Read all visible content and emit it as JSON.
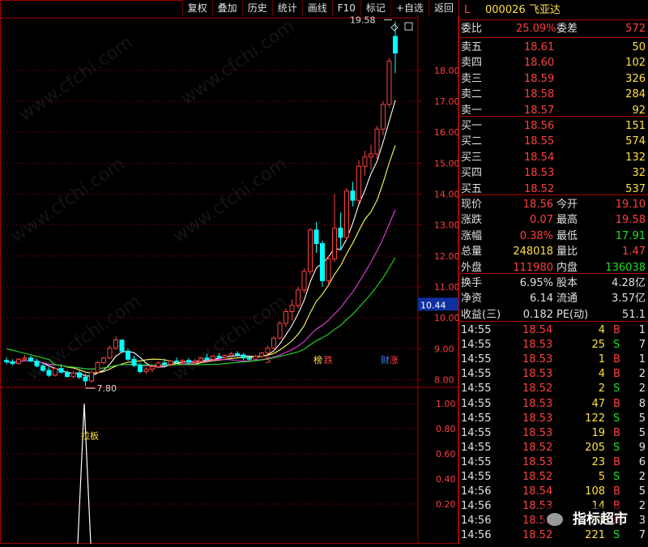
{
  "toolbar": {
    "buttons": [
      "复权",
      "叠加",
      "历史",
      "统计",
      "画线",
      "F10",
      "标记",
      "+自选",
      "返回"
    ]
  },
  "stock": {
    "flag": "L",
    "code": "000026",
    "name": "飞亚达"
  },
  "ratio": {
    "wb_label": "委比",
    "wb_value": "25.09%",
    "wc_label": "委差",
    "wc_value": "572"
  },
  "asks": [
    {
      "label": "卖五",
      "price": "18.61",
      "vol": "50"
    },
    {
      "label": "卖四",
      "price": "18.60",
      "vol": "102"
    },
    {
      "label": "卖三",
      "price": "18.59",
      "vol": "326"
    },
    {
      "label": "卖二",
      "price": "18.58",
      "vol": "284"
    },
    {
      "label": "卖一",
      "price": "18.57",
      "vol": "92"
    }
  ],
  "bids": [
    {
      "label": "买一",
      "price": "18.56",
      "vol": "151"
    },
    {
      "label": "买二",
      "price": "18.55",
      "vol": "574"
    },
    {
      "label": "买三",
      "price": "18.54",
      "vol": "132"
    },
    {
      "label": "买四",
      "price": "18.53",
      "vol": "32"
    },
    {
      "label": "买五",
      "price": "18.52",
      "vol": "537"
    }
  ],
  "stats": [
    {
      "l1": "现价",
      "v1": "18.56",
      "l2": "今开",
      "v2": "19.10"
    },
    {
      "l1": "涨跌",
      "v1": "0.07",
      "l2": "最高",
      "v2": "19.58"
    },
    {
      "l1": "涨幅",
      "v1": "0.38%",
      "l2": "最低",
      "v2": "17.91"
    },
    {
      "l1": "总量",
      "v1": "248018",
      "l2": "量比",
      "v2": "1.47"
    },
    {
      "l1": "外盘",
      "v1": "111980",
      "l2": "内盘",
      "v2": "136038"
    }
  ],
  "stats2": [
    {
      "l1": "换手",
      "v1": "6.95%",
      "l2": "股本",
      "v2": "4.28亿"
    },
    {
      "l1": "净资",
      "v1": "6.14",
      "l2": "流通",
      "v2": "3.57亿"
    },
    {
      "l1": "收益(三)",
      "v1": "0.182",
      "l2": "PE(动)",
      "v2": "51.1"
    }
  ],
  "ticks": [
    {
      "time": "14:55",
      "price": "18.54",
      "vol": "4",
      "side": "B",
      "n": "1"
    },
    {
      "time": "14:55",
      "price": "18.53",
      "vol": "25",
      "side": "S",
      "n": "7"
    },
    {
      "time": "14:55",
      "price": "18.53",
      "vol": "1",
      "side": "B",
      "n": "1"
    },
    {
      "time": "14:55",
      "price": "18.53",
      "vol": "4",
      "side": "B",
      "n": "2"
    },
    {
      "time": "14:55",
      "price": "18.52",
      "vol": "2",
      "side": "S",
      "n": "2"
    },
    {
      "time": "14:55",
      "price": "18.53",
      "vol": "47",
      "side": "B",
      "n": "8"
    },
    {
      "time": "14:55",
      "price": "18.53",
      "vol": "122",
      "side": "S",
      "n": "5"
    },
    {
      "time": "14:55",
      "price": "18.53",
      "vol": "19",
      "side": "B",
      "n": "5"
    },
    {
      "time": "14:55",
      "price": "18.52",
      "vol": "205",
      "side": "S",
      "n": "9"
    },
    {
      "time": "14:55",
      "price": "18.53",
      "vol": "23",
      "side": "B",
      "n": "6"
    },
    {
      "time": "14:55",
      "price": "18.52",
      "vol": "5",
      "side": "S",
      "n": "2"
    },
    {
      "time": "14:56",
      "price": "18.54",
      "vol": "108",
      "side": "B",
      "n": "5"
    },
    {
      "time": "14:56",
      "price": "18.53",
      "vol": "14",
      "side": "B",
      "n": "2"
    },
    {
      "time": "14:56",
      "price": "18.53",
      "vol": "4",
      "side": "B",
      "n": "3"
    },
    {
      "time": "14:56",
      "price": "18.52",
      "vol": "221",
      "side": "S",
      "n": "7"
    }
  ],
  "annotations": {
    "high": "19.58",
    "low": "7.80",
    "s_mark": "S",
    "rank_label": "榜",
    "rank_value": "跌",
    "cai_label": "财",
    "cai_value": "涨",
    "pull_label": "拉板"
  },
  "price_badge": "10.44",
  "watermark": "www.cfchi.com",
  "brand": {
    "text": "指标超市"
  },
  "colors": {
    "up": "#ff4040",
    "down": "#00ffff",
    "ma5": "#ffffff",
    "ma10": "#ffff60",
    "ma20": "#e040e0",
    "ma60": "#20e020",
    "grid": "#a00000"
  },
  "chart_data": {
    "type": "candlestick",
    "y_ticks": [
      8.0,
      9.0,
      10.0,
      11.0,
      12.0,
      13.0,
      14.0,
      15.0,
      16.0,
      17.0,
      18.0
    ],
    "y_tick_labels": [
      "8.00",
      "9.00",
      "10.00",
      "11.00",
      "12.00",
      "13.00",
      "14.00",
      "15.00",
      "16.00",
      "17.00",
      "18.00"
    ],
    "ylim": [
      7.75,
      19.7
    ],
    "candles": [
      [
        8.62,
        8.72,
        8.5,
        8.58
      ],
      [
        8.58,
        8.66,
        8.46,
        8.52
      ],
      [
        8.52,
        8.7,
        8.48,
        8.66
      ],
      [
        8.66,
        8.8,
        8.6,
        8.7
      ],
      [
        8.7,
        8.78,
        8.56,
        8.6
      ],
      [
        8.6,
        8.68,
        8.4,
        8.44
      ],
      [
        8.44,
        8.55,
        8.24,
        8.3
      ],
      [
        8.3,
        8.4,
        8.08,
        8.14
      ],
      [
        8.14,
        8.4,
        8.1,
        8.36
      ],
      [
        8.36,
        8.5,
        8.2,
        8.24
      ],
      [
        8.24,
        8.3,
        8.06,
        8.1
      ],
      [
        8.1,
        8.28,
        8.04,
        8.22
      ],
      [
        8.22,
        8.3,
        8.02,
        8.08
      ],
      [
        8.08,
        8.2,
        7.8,
        7.96
      ],
      [
        7.96,
        8.3,
        7.9,
        8.24
      ],
      [
        8.24,
        8.6,
        8.2,
        8.55
      ],
      [
        8.55,
        8.74,
        8.5,
        8.7
      ],
      [
        8.7,
        9.1,
        8.66,
        9.02
      ],
      [
        9.02,
        9.4,
        8.96,
        9.28
      ],
      [
        9.28,
        9.3,
        8.86,
        8.92
      ],
      [
        8.92,
        9.0,
        8.6,
        8.66
      ],
      [
        8.66,
        8.78,
        8.4,
        8.46
      ],
      [
        8.46,
        8.55,
        8.2,
        8.26
      ],
      [
        8.26,
        8.4,
        8.18,
        8.34
      ],
      [
        8.34,
        8.46,
        8.24,
        8.42
      ],
      [
        8.42,
        8.6,
        8.38,
        8.54
      ],
      [
        8.54,
        8.68,
        8.44,
        8.5
      ],
      [
        8.5,
        8.64,
        8.44,
        8.6
      ],
      [
        8.6,
        8.72,
        8.52,
        8.58
      ],
      [
        8.58,
        8.66,
        8.48,
        8.62
      ],
      [
        8.62,
        8.7,
        8.5,
        8.56
      ],
      [
        8.56,
        8.66,
        8.48,
        8.6
      ],
      [
        8.6,
        8.74,
        8.56,
        8.7
      ],
      [
        8.7,
        8.84,
        8.62,
        8.66
      ],
      [
        8.66,
        8.8,
        8.6,
        8.76
      ],
      [
        8.76,
        8.86,
        8.68,
        8.72
      ],
      [
        8.72,
        8.82,
        8.64,
        8.78
      ],
      [
        8.78,
        8.9,
        8.7,
        8.84
      ],
      [
        8.84,
        8.92,
        8.74,
        8.8
      ],
      [
        8.8,
        8.86,
        8.64,
        8.7
      ],
      [
        8.7,
        8.76,
        8.58,
        8.66
      ],
      [
        8.66,
        8.8,
        8.6,
        8.76
      ],
      [
        8.76,
        8.9,
        8.7,
        8.86
      ],
      [
        8.86,
        9.1,
        8.82,
        9.02
      ],
      [
        9.02,
        9.4,
        8.98,
        9.34
      ],
      [
        9.34,
        9.9,
        9.3,
        9.82
      ],
      [
        9.82,
        10.3,
        9.7,
        10.2
      ],
      [
        10.2,
        10.6,
        9.9,
        10.4
      ],
      [
        10.4,
        11.0,
        10.3,
        10.9
      ],
      [
        10.9,
        11.6,
        10.8,
        11.5
      ],
      [
        11.5,
        12.9,
        11.4,
        12.84
      ],
      [
        12.84,
        13.1,
        12.1,
        12.4
      ],
      [
        12.4,
        12.5,
        11.0,
        11.2
      ],
      [
        11.2,
        12.0,
        11.1,
        11.9
      ],
      [
        11.9,
        14.0,
        11.8,
        12.9
      ],
      [
        12.9,
        13.4,
        12.2,
        12.6
      ],
      [
        12.6,
        14.2,
        12.5,
        14.1
      ],
      [
        14.1,
        14.4,
        13.6,
        13.8
      ],
      [
        13.8,
        15.1,
        13.7,
        14.9
      ],
      [
        14.9,
        15.4,
        14.6,
        15.2
      ],
      [
        15.2,
        15.6,
        14.8,
        15.3
      ],
      [
        15.3,
        16.2,
        15.1,
        16.1
      ],
      [
        16.1,
        17.0,
        15.9,
        16.9
      ],
      [
        16.9,
        18.4,
        16.8,
        18.3
      ],
      [
        19.1,
        19.58,
        17.91,
        18.56
      ]
    ],
    "volume_peak": {
      "value": 1.0
    },
    "volume_ticks": [
      "1.00",
      "0.80",
      "0.60",
      "0.40",
      "0.20"
    ]
  }
}
